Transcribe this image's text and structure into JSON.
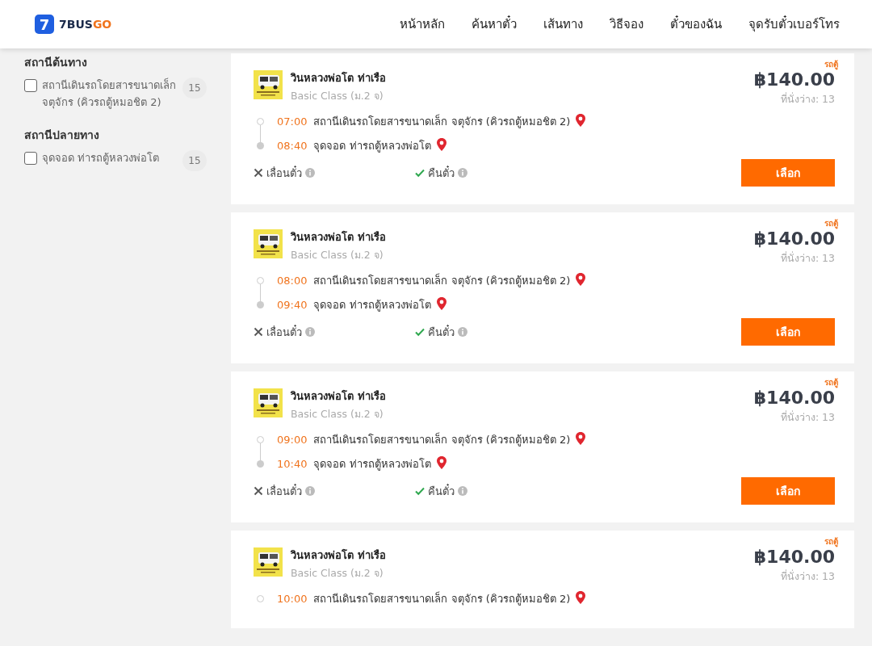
{
  "header": {
    "logo": {
      "mark": "7",
      "word_a": "7BUS",
      "word_b": "GO"
    },
    "nav": [
      "หน้าหลัก",
      "ค้นหาตั๋ว",
      "เส้นทาง",
      "วิธีจอง",
      "ตั๋วของฉัน",
      "จุดรับตั๋วเบอร์โทร"
    ]
  },
  "sidebar": {
    "groups": [
      {
        "title": "สถานีต้นทาง",
        "options": [
          {
            "label": "สถานีเดินรถโดยสารขนาดเล็ก จตุจักร (คิวรถตู้หมอชิต 2)",
            "count": "15",
            "checked": false
          }
        ]
      },
      {
        "title": "สถานีปลายทาง",
        "options": [
          {
            "label": "จุดจอด ท่ารถตู้หลวงพ่อโต",
            "count": "15",
            "checked": false
          }
        ]
      }
    ]
  },
  "trips": [
    {
      "tag": "รถตู้",
      "operator": "วินหลวงพ่อโต ท่าเรือ",
      "class": "Basic Class (ม.2 จ)",
      "price": "฿140.00",
      "seats": "ที่นั่งว่าง: 13",
      "stops": [
        {
          "time": "07:00",
          "place": "สถานีเดินรถโดยสารขนาดเล็ก จตุจักร (คิวรถตู้หมอชิต 2)",
          "kind": "origin"
        },
        {
          "time": "08:40",
          "place": "จุดจอด ท่ารถตู้หลวงพ่อโต",
          "kind": "destination"
        }
      ],
      "policies": [
        {
          "label": "เลื่อนตั๋ว",
          "allowed": false
        },
        {
          "label": "คืนตั๋ว",
          "allowed": true
        }
      ],
      "button": "เลือก"
    },
    {
      "tag": "รถตู้",
      "operator": "วินหลวงพ่อโต ท่าเรือ",
      "class": "Basic Class (ม.2 จ)",
      "price": "฿140.00",
      "seats": "ที่นั่งว่าง: 13",
      "stops": [
        {
          "time": "08:00",
          "place": "สถานีเดินรถโดยสารขนาดเล็ก จตุจักร (คิวรถตู้หมอชิต 2)",
          "kind": "origin"
        },
        {
          "time": "09:40",
          "place": "จุดจอด ท่ารถตู้หลวงพ่อโต",
          "kind": "destination"
        }
      ],
      "policies": [
        {
          "label": "เลื่อนตั๋ว",
          "allowed": false
        },
        {
          "label": "คืนตั๋ว",
          "allowed": true
        }
      ],
      "button": "เลือก"
    },
    {
      "tag": "รถตู้",
      "operator": "วินหลวงพ่อโต ท่าเรือ",
      "class": "Basic Class (ม.2 จ)",
      "price": "฿140.00",
      "seats": "ที่นั่งว่าง: 13",
      "stops": [
        {
          "time": "09:00",
          "place": "สถานีเดินรถโดยสารขนาดเล็ก จตุจักร (คิวรถตู้หมอชิต 2)",
          "kind": "origin"
        },
        {
          "time": "10:40",
          "place": "จุดจอด ท่ารถตู้หลวงพ่อโต",
          "kind": "destination"
        }
      ],
      "policies": [
        {
          "label": "เลื่อนตั๋ว",
          "allowed": false
        },
        {
          "label": "คืนตั๋ว",
          "allowed": true
        }
      ],
      "button": "เลือก"
    },
    {
      "tag": "รถตู้",
      "operator": "วินหลวงพ่อโต ท่าเรือ",
      "class": "Basic Class (ม.2 จ)",
      "price": "฿140.00",
      "seats": "ที่นั่งว่าง: 13",
      "stops": [
        {
          "time": "10:00",
          "place": "สถานีเดินรถโดยสารขนาดเล็ก จตุจักร (คิวรถตู้หมอชิต 2)",
          "kind": "origin"
        }
      ]
    }
  ]
}
